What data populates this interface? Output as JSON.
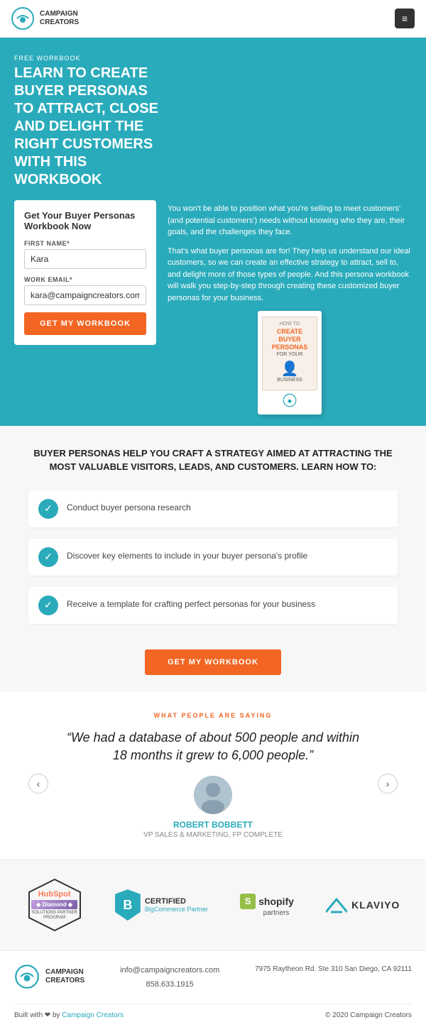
{
  "header": {
    "logo_brand": "CAMPAIGN\nCREATORS",
    "menu_icon": "≡"
  },
  "hero": {
    "free_label": "FREE WORKBOOK",
    "title": "LEARN TO CREATE BUYER PERSONAS TO ATTRACT, CLOSE AND DELIGHT THE RIGHT CUSTOMERS WITH THIS WORKBOOK",
    "description1": "You won't be able to position what you're selling to meet customers' (and potential customers') needs without knowing who they are, their goals, and the challenges they face.",
    "description2": "That's what buyer personas are for! They help us understand our ideal customers, so we can create an effective strategy to attract, sell to, and delight more of those types of people. And this persona workbook will walk you step-by-step through creating these customized buyer personas for your business.",
    "form": {
      "title": "Get Your Buyer Personas Workbook Now",
      "first_name_label": "FIRST NAME*",
      "first_name_value": "Kara",
      "work_email_label": "WORK EMAIL*",
      "work_email_value": "kara@campaigncreators.com",
      "cta_button": "GET MY WORKBOOK"
    },
    "book": {
      "how": "HOW TO",
      "title": "CREATE BUYER PERSONAS",
      "sub": "FOR YOUR",
      "sub2": "BUSINESS"
    }
  },
  "features": {
    "title": "BUYER PERSONAS HELP YOU CRAFT A STRATEGY AIMED AT ATTRACTING THE MOST VALUABLE VISITORS, LEADS, AND CUSTOMERS. LEARN HOW TO:",
    "items": [
      "Conduct buyer persona research",
      "Discover key elements to include in your buyer persona's profile",
      "Receive a template for crafting perfect personas for your business"
    ],
    "cta_button": "GET MY WORKBOOK"
  },
  "testimonial": {
    "section_label": "WHAT PEOPLE ARE SAYING",
    "quote": "“We had a database of about 500 people and within 18 months it grew to 6,000 people.”",
    "person_name": "ROBERT BOBBETT",
    "person_role": "VP SALES & MARKETING, FP COMPLETE",
    "prev_btn": "‹",
    "next_btn": "›"
  },
  "partners": {
    "hubspot": {
      "name": "HubSpot",
      "tier": "◆ Diamond ◆",
      "sub1": "SOLUTIONS PARTNER",
      "sub2": "PROGRAM"
    },
    "bigcommerce": {
      "badge": "B",
      "certified": "CERTIFIED",
      "partner": "BigCommerce Partner"
    },
    "shopify": {
      "letter": "S",
      "label": "shopify",
      "sub": "partners"
    },
    "klaviyo": {
      "label": "KLAVIYO"
    }
  },
  "footer": {
    "brand": "CAMPAIGN\nCREATORS",
    "email": "info@campaigncreators.com",
    "phone": "858.633.1915",
    "address": "7975 Raytheon Rd. Ste 310 San Diego, CA 92111",
    "built_by": "Built with ❤ by",
    "built_link": "Campaign Creators",
    "copyright": "© 2020 Campaign Creators"
  }
}
